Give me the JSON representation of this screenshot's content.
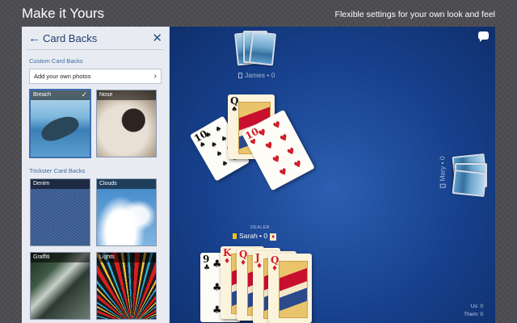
{
  "header": {
    "title": "Make it Yours",
    "tagline": "Flexible settings for your own look and feel"
  },
  "panel": {
    "title": "Card Backs",
    "custom_section": "Custom Card Backs",
    "add_photos": "Add your own photos",
    "custom_items": [
      {
        "label": "Breach",
        "selected": true
      },
      {
        "label": "Nose",
        "selected": false
      }
    ],
    "trickster_section": "Trickster Card Backs",
    "trickster_items": [
      {
        "label": "Denim"
      },
      {
        "label": "Clouds"
      },
      {
        "label": "Graffiti"
      },
      {
        "label": "Lights"
      }
    ]
  },
  "table": {
    "players": {
      "north": {
        "name": "James",
        "score": "0"
      },
      "east": {
        "name": "Mary",
        "score": "0"
      },
      "south": {
        "name": "Sarah",
        "score": "0",
        "dealer_label": "DEALER"
      }
    },
    "trick": [
      {
        "rank": "10",
        "suit": "♠"
      },
      {
        "rank": "Q",
        "suit": "♠"
      },
      {
        "rank": "10",
        "suit": "♥"
      }
    ],
    "hand": [
      {
        "rank": "9",
        "suit": "♣"
      },
      {
        "rank": "K",
        "suit": "♦"
      },
      {
        "rank": "Q",
        "suit": "♦"
      },
      {
        "rank": "J",
        "suit": "♦"
      },
      {
        "rank": "Q",
        "suit": "♦"
      }
    ],
    "scores": {
      "us_label": "Us:",
      "us_value": "0",
      "them_label": "Them:",
      "them_value": "0"
    },
    "colors": {
      "felt": "#17418d",
      "accent": "#3c6fb4",
      "dealer_flag": "#f2c314"
    }
  }
}
